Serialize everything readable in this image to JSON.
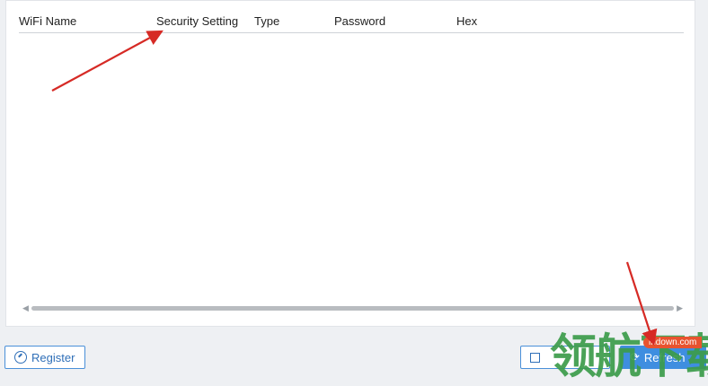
{
  "table": {
    "columns": [
      "WiFi Name",
      "Security Setting",
      "Type",
      "Password",
      "Hex"
    ],
    "rows": []
  },
  "buttons": {
    "register": "Register",
    "refresh": "Refresh"
  },
  "watermark": {
    "site": "lhdown.com",
    "text": "领航下载"
  },
  "colors": {
    "accent": "#3f8ee0",
    "annotation_arrow": "#d62a25",
    "watermark_green": "#3c9c4a"
  },
  "icons": {
    "register": "register-icon",
    "save": "save-icon",
    "refresh": "refresh-icon",
    "scroll_left": "scroll-left-arrow-icon",
    "scroll_right": "scroll-right-arrow-icon"
  }
}
